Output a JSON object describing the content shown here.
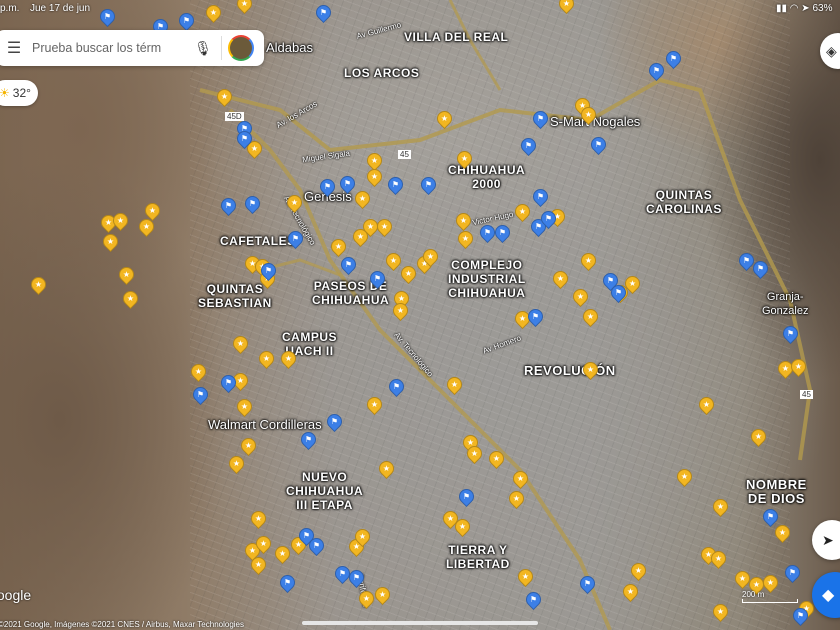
{
  "status_bar": {
    "time": "p.m.",
    "date": "Jue 17 de jun",
    "battery": "63%"
  },
  "search": {
    "placeholder": "Prueba buscar los térm"
  },
  "weather": {
    "temp": "32°"
  },
  "places": {
    "aldabas": "Aldabas",
    "villa_del_real": "VILLA DEL REAL",
    "los_arcos": "LOS ARCOS",
    "smart": "S-Mart Nogales",
    "chihuahua2000": "CHIHUAHUA\n2000",
    "quintas_carolinas": "QUINTAS\nCAROLINAS",
    "genesis": "Genesis",
    "cafetales": "CAFETALES",
    "complejo": "COMPLEJO\nINDUSTRIAL\nCHIHUAHUA",
    "quintas_sebastian": "QUINTAS\nSEBASTIAN",
    "paseos": "PASEOS DE\nCHIHUAHUA",
    "campus": "CAMPUS\nUACH II",
    "revolucion": "REVOLUCIÓN",
    "granja": "Granja-\nGonzalez",
    "walmart": "Walmart Cordilleras",
    "nuevo": "NUEVO\nCHIHUAHUA\nIII ETAPA",
    "tierra": "TIERRA Y\nLIBERTAD",
    "nombre": "NOMBRE\nDE DIOS"
  },
  "streets": {
    "guillermo": "Av Guillermo",
    "arcos": "Av. los Arcos",
    "sigala": "Miguel Sigala",
    "tecnologico1": "Av. Tecnológico",
    "tecnologico2": "Av. Tecnológico",
    "victor": "Victor Hugo",
    "homero": "Av Homero",
    "hwy45d": "45D",
    "hwy45": "45",
    "hwy45b": "45",
    "pacheco": "Periférico"
  },
  "scale": "200 m",
  "google": "Google",
  "attribution": "©2021 Google, Imágenes ©2021 CNES / Airbus, Maxar Technologies",
  "icons": {
    "menu": "menu-icon",
    "mic": "mic-icon",
    "layers": "layers-icon",
    "locate": "navigation-arrow-icon",
    "directions": "directions-icon",
    "star_pin": "star-pin-icon",
    "flag_pin": "flag-pin-icon"
  },
  "colors": {
    "star_pin": "#f2b621",
    "flag_pin": "#3c7fe6",
    "directions": "#1a73e8"
  }
}
